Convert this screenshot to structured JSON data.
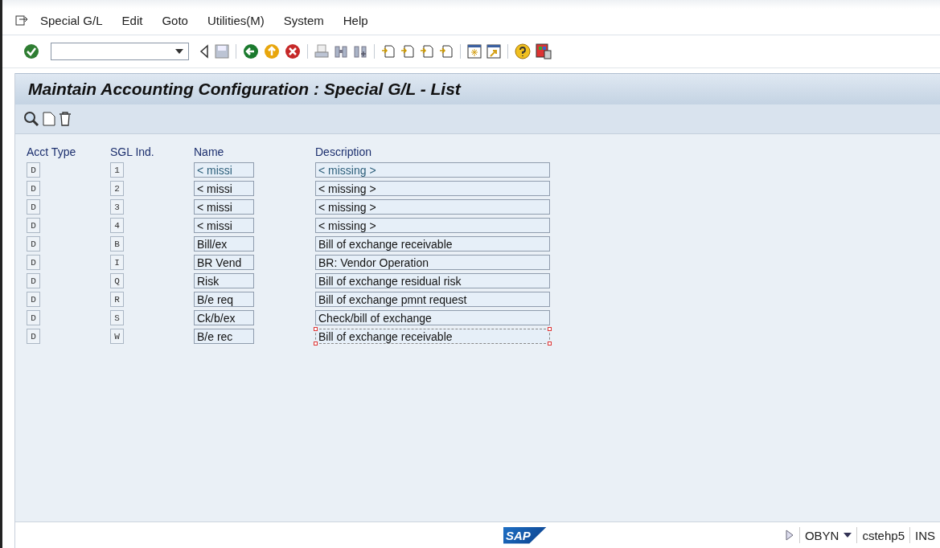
{
  "menu": [
    "Special G/L",
    "Edit",
    "Goto",
    "Utilities(M)",
    "System",
    "Help"
  ],
  "screen_title": "Maintain Accounting Configuration : Special G/L - List",
  "table": {
    "columns": [
      "Acct Type",
      "SGL Ind.",
      "Name",
      "Description"
    ],
    "rows": [
      {
        "acct_type": "D",
        "sgl_ind": "1",
        "name": "< missi",
        "description": "< missing >",
        "focused": true,
        "selected": false
      },
      {
        "acct_type": "D",
        "sgl_ind": "2",
        "name": "< missi",
        "description": "< missing >",
        "focused": false,
        "selected": false
      },
      {
        "acct_type": "D",
        "sgl_ind": "3",
        "name": "< missi",
        "description": "< missing >",
        "focused": false,
        "selected": false
      },
      {
        "acct_type": "D",
        "sgl_ind": "4",
        "name": "< missi",
        "description": "< missing >",
        "focused": false,
        "selected": false
      },
      {
        "acct_type": "D",
        "sgl_ind": "B",
        "name": "Bill/ex",
        "description": "Bill of exchange receivable",
        "focused": false,
        "selected": false
      },
      {
        "acct_type": "D",
        "sgl_ind": "I",
        "name": "BR Vend",
        "description": "BR: Vendor Operation",
        "focused": false,
        "selected": false
      },
      {
        "acct_type": "D",
        "sgl_ind": "Q",
        "name": "Risk",
        "description": "Bill of exchange residual risk",
        "focused": false,
        "selected": false
      },
      {
        "acct_type": "D",
        "sgl_ind": "R",
        "name": "B/e req",
        "description": "Bill of exchange pmnt request",
        "focused": false,
        "selected": false
      },
      {
        "acct_type": "D",
        "sgl_ind": "S",
        "name": "Ck/b/ex",
        "description": "Check/bill of exchange",
        "focused": false,
        "selected": false
      },
      {
        "acct_type": "D",
        "sgl_ind": "W",
        "name": "B/e rec",
        "description": "Bill of exchange receivable",
        "focused": false,
        "selected": true
      }
    ]
  },
  "status_bar": {
    "logo": "SAP",
    "transaction": "OBYN",
    "server": "cstehp5",
    "mode": "INS"
  }
}
